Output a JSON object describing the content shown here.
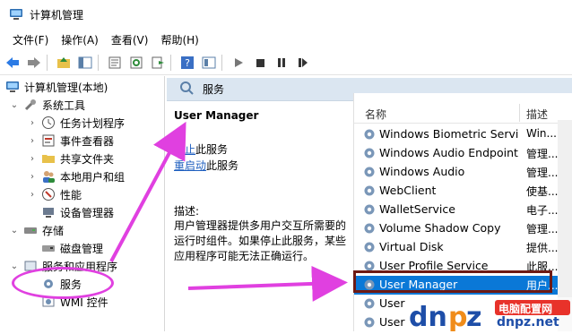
{
  "window": {
    "title": "计算机管理"
  },
  "menu": [
    "文件(F)",
    "操作(A)",
    "查看(V)",
    "帮助(H)"
  ],
  "tree": {
    "root": "计算机管理(本地)",
    "items": [
      {
        "label": "系统工具",
        "level": 1,
        "arrow": "⌄"
      },
      {
        "label": "任务计划程序",
        "level": 2,
        "arrow": "›"
      },
      {
        "label": "事件查看器",
        "level": 2,
        "arrow": "›"
      },
      {
        "label": "共享文件夹",
        "level": 2,
        "arrow": "›"
      },
      {
        "label": "本地用户和组",
        "level": 2,
        "arrow": "›"
      },
      {
        "label": "性能",
        "level": 2,
        "arrow": "›"
      },
      {
        "label": "设备管理器",
        "level": 2,
        "arrow": ""
      },
      {
        "label": "存储",
        "level": 1,
        "arrow": "⌄"
      },
      {
        "label": "磁盘管理",
        "level": 2,
        "arrow": ""
      },
      {
        "label": "服务和应用程序",
        "level": 1,
        "arrow": "⌄"
      },
      {
        "label": "服务",
        "level": 2,
        "arrow": ""
      },
      {
        "label": "WMI 控件",
        "level": 2,
        "arrow": ""
      }
    ]
  },
  "panel": {
    "title": "服务"
  },
  "details": {
    "service_name": "User Manager",
    "stop_link": "停止",
    "stop_suffix": "此服务",
    "restart_link": "重启动",
    "restart_suffix": "此服务",
    "description_label": "描述:",
    "description": "用户管理器提供多用户交互所需要的运行时组件。如果停止此服务，某些应用程序可能无法正确运行。"
  },
  "list": {
    "col_name": "名称",
    "col_desc": "描述",
    "rows": [
      {
        "name": "Windows Biometric Servi...",
        "desc": "Win..."
      },
      {
        "name": "Windows Audio Endpoint...",
        "desc": "管理..."
      },
      {
        "name": "Windows Audio",
        "desc": "管理..."
      },
      {
        "name": "WebClient",
        "desc": "使基..."
      },
      {
        "name": "WalletService",
        "desc": "电子..."
      },
      {
        "name": "Volume Shadow Copy",
        "desc": "管理..."
      },
      {
        "name": "Virtual Disk",
        "desc": "提供..."
      },
      {
        "name": "User Profile Service",
        "desc": "此服..."
      },
      {
        "name": "User Manager",
        "desc": "用户..."
      },
      {
        "name": "User",
        "desc": ""
      },
      {
        "name": "User",
        "desc": ""
      }
    ],
    "selected_index": 8
  },
  "watermark": {
    "text": "电脑配置网",
    "brand": "dnpz.net"
  },
  "colors": {
    "selection": "#0a78d7",
    "annotation": "#e040e0",
    "box": "#6e1a14",
    "header": "#dbe6f1"
  }
}
